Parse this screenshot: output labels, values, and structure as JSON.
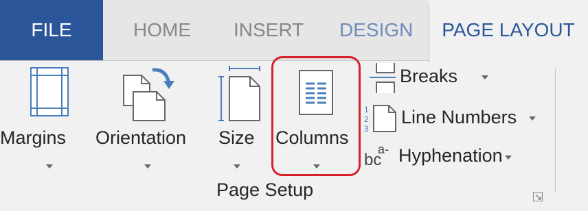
{
  "tabs": [
    {
      "label": "FILE"
    },
    {
      "label": "HOME"
    },
    {
      "label": "INSERT"
    },
    {
      "label": "DESIGN"
    },
    {
      "label": "PAGE LAYOUT"
    }
  ],
  "ribbon": {
    "group_label": "Page Setup",
    "large_buttons": [
      {
        "label": "Margins",
        "icon": "margins-icon"
      },
      {
        "label": "Orientation",
        "icon": "orientation-icon"
      },
      {
        "label": "Size",
        "icon": "size-icon"
      },
      {
        "label": "Columns",
        "icon": "columns-icon"
      }
    ],
    "small_buttons": [
      {
        "label": "Breaks",
        "icon": "breaks-icon"
      },
      {
        "label": "Line Numbers",
        "icon": "line-numbers-icon"
      },
      {
        "label": "Hyphenation",
        "icon": "hyphenation-icon"
      }
    ],
    "hyphenation_glyph": "bc",
    "hyphenation_glyph_sup": "a-"
  },
  "colors": {
    "file_tab": "#2b579a",
    "active_tab_text": "#2b579a",
    "highlight": "#d6202a",
    "icon_blue": "#4a7ebb"
  }
}
